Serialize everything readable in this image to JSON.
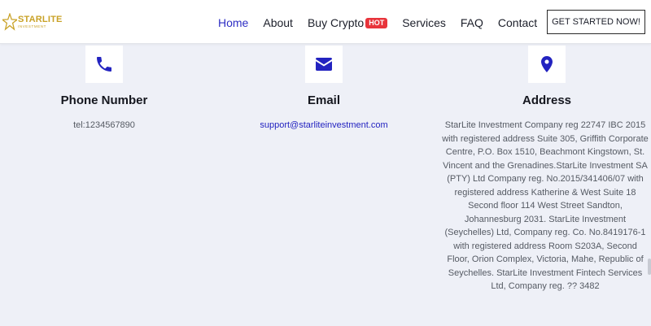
{
  "header": {
    "logo_main": "STARLITE",
    "logo_sub": "INVESTMENT",
    "nav": [
      {
        "label": "Home",
        "active": true
      },
      {
        "label": "About"
      },
      {
        "label": "Buy Crypto",
        "badge": "HOT"
      },
      {
        "label": "Services"
      },
      {
        "label": "FAQ"
      },
      {
        "label": "Contact"
      }
    ],
    "cta_label": "GET STARTED NOW!"
  },
  "contact": {
    "phone": {
      "title": "Phone Number",
      "value": "tel:1234567890",
      "icon": "phone-icon"
    },
    "email": {
      "title": "Email",
      "value": "support@starliteinvestment.com",
      "icon": "envelope-icon"
    },
    "address": {
      "title": "Address",
      "icon": "map-pin-icon",
      "value": "StarLite Investment Company reg 22747 IBC 2015 with registered address Suite 305, Griffith Corporate Centre, P.O. Box 1510, Beachmont Kingstown, St. Vincent and the Grenadines.StarLite Investment SA (PTY) Ltd Company reg. No.2015/341406/07 with registered address Katherine & West Suite 18 Second floor 114 West Street Sandton, Johannesburg 2031. StarLite Investment (Seychelles) Ltd, Company reg. Co. No.8419176-1 with registered address Room S203A, Second Floor, Orion Complex, Victoria, Mahe, Republic of Seychelles. StarLite Investment Fintech Services Ltd, Company reg. ?? 3482"
    }
  },
  "colors": {
    "accent": "#2e2ec4",
    "icon": "#2323c0",
    "hot": "#e8343b",
    "logo": "#c9a227",
    "background": "#eef0f7"
  }
}
